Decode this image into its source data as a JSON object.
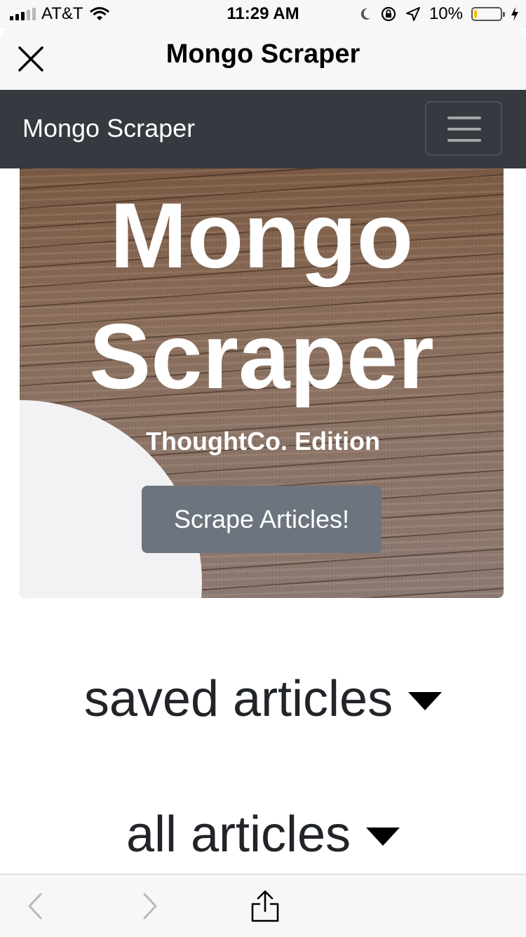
{
  "status_bar": {
    "carrier": "AT&T",
    "time": "11:29 AM",
    "battery_percent": "10%",
    "battery_level": 0.1,
    "icons": [
      "signal-icon",
      "wifi-icon",
      "moon-icon",
      "rotation-lock-icon",
      "location-icon",
      "battery-icon",
      "charging-icon"
    ]
  },
  "sheet": {
    "title": "Mongo Scraper",
    "close_icon": "close-icon"
  },
  "navbar": {
    "brand": "Mongo Scraper",
    "toggler_icon": "hamburger-icon"
  },
  "jumbotron": {
    "title": "Mongo Scraper",
    "subtitle": "ThoughtCo. Edition",
    "button_label": "Scrape Articles!"
  },
  "sections": {
    "saved": "saved articles",
    "all": "all articles"
  },
  "toolbar": {
    "icons": [
      "back-icon",
      "forward-icon",
      "share-icon"
    ]
  },
  "colors": {
    "navbar_bg": "#343a40",
    "button_bg": "#6c757d",
    "battery_fill": "#f5c400"
  }
}
